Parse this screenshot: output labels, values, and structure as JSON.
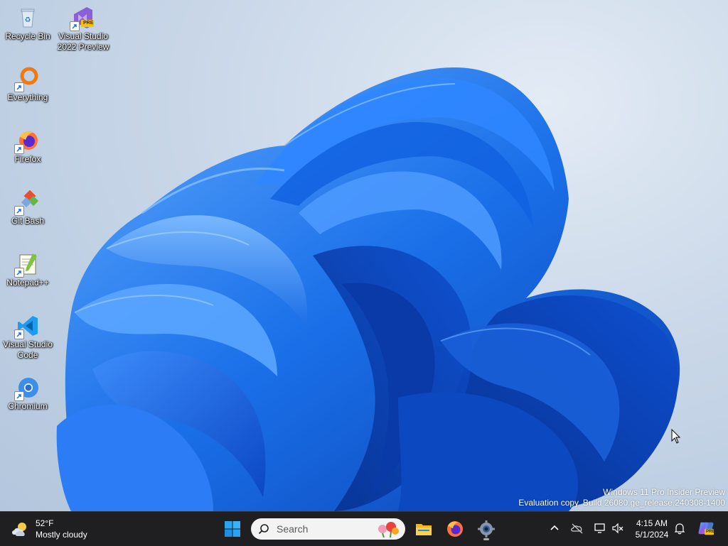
{
  "desktop": {
    "icons": [
      {
        "label": "Recycle Bin",
        "icon": "recycle-bin-icon"
      },
      {
        "label": "Visual Studio 2022 Preview",
        "icon": "visual-studio-preview-icon",
        "badge": "PRE"
      },
      {
        "label": "Everything",
        "icon": "everything-icon"
      },
      {
        "label": "Firefox",
        "icon": "firefox-icon"
      },
      {
        "label": "Git Bash",
        "icon": "git-bash-icon"
      },
      {
        "label": "Notepad++",
        "icon": "notepad-plus-plus-icon"
      },
      {
        "label": "Visual Studio Code",
        "icon": "vscode-icon"
      },
      {
        "label": "Chromium",
        "icon": "chromium-icon"
      }
    ],
    "watermark": {
      "line1": "Windows 11 Pro Insider Preview",
      "line2": "Evaluation copy. Build 26080.ge_release.240308-1400"
    }
  },
  "taskbar": {
    "weather": {
      "temp": "52°F",
      "condition": "Mostly cloudy",
      "icon": "cloudy-weather-icon"
    },
    "search": {
      "placeholder": "Search"
    },
    "pinned": [
      {
        "name": "start",
        "icon": "windows-start-icon"
      },
      {
        "name": "file-explorer",
        "icon": "folder-icon"
      },
      {
        "name": "firefox",
        "icon": "firefox-icon"
      },
      {
        "name": "settings",
        "icon": "gear-icon"
      }
    ],
    "tray": {
      "time": "4:15 AM",
      "date": "5/1/2024",
      "icons": [
        "chevron-up-icon",
        "onedrive-icon",
        "network-icon",
        "volume-muted-icon",
        "bell-icon",
        "copilot-icon"
      ],
      "copilot_badge": "PRE"
    }
  },
  "colors": {
    "taskbar_bg": "#1f1f22",
    "bloom_primary": "#1a6fe8",
    "accent": "#0078d4"
  }
}
